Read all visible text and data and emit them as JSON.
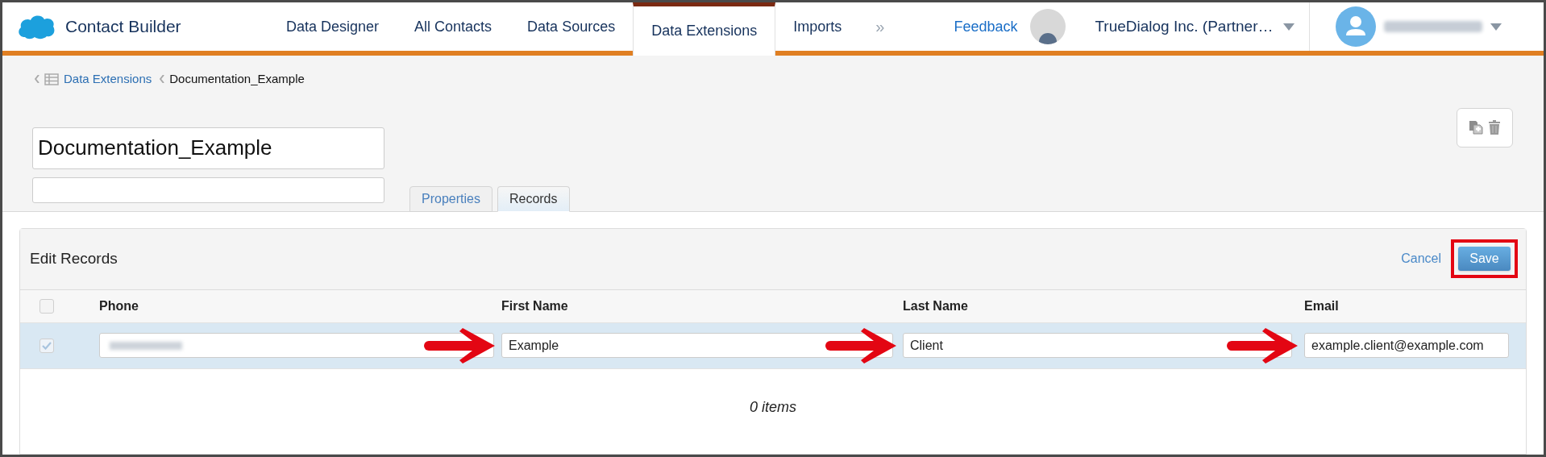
{
  "app": {
    "title": "Contact Builder"
  },
  "nav": [
    {
      "label": "Data Designer",
      "selected": false
    },
    {
      "label": "All Contacts",
      "selected": false
    },
    {
      "label": "Data Sources",
      "selected": false
    },
    {
      "label": "Data Extensions",
      "selected": true
    },
    {
      "label": "Imports",
      "selected": false
    }
  ],
  "nav_more": "»",
  "feedback": "Feedback",
  "account": "TrueDialog Inc. (Partner…",
  "breadcrumb": [
    {
      "label": "Data Extensions",
      "kind": "link"
    },
    {
      "label": "Documentation_Example",
      "kind": "current"
    }
  ],
  "name_field": {
    "value": "Documentation_Example"
  },
  "tabs": [
    {
      "label": "Properties",
      "selected": false
    },
    {
      "label": "Records",
      "selected": true
    }
  ],
  "panel": {
    "title": "Edit Records",
    "cancel": "Cancel",
    "save": {
      "label": "Save",
      "highlighted": true
    }
  },
  "table": {
    "header_checked": false,
    "columns": [
      "Phone",
      "First Name",
      "Last Name",
      "Email"
    ],
    "rows": [
      {
        "checked": true,
        "selected": true,
        "cells": [
          {
            "kind": "blurred",
            "arrow": false
          },
          {
            "kind": "text",
            "value": "Example",
            "arrow": true
          },
          {
            "kind": "text",
            "value": "Client",
            "arrow": true
          },
          {
            "kind": "text",
            "value": "example.client@example.com",
            "arrow": true
          }
        ]
      }
    ]
  },
  "footer": "0 items"
}
